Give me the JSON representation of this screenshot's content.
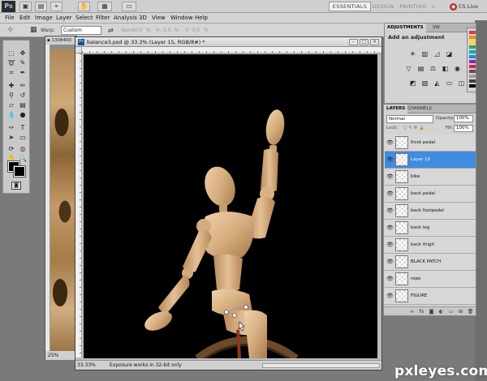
{
  "app": {
    "logo": "Ps",
    "workspaces": [
      "ESSENTIALS",
      "DESIGN",
      "PAINTING",
      "»"
    ],
    "cslive": "CS Live"
  },
  "menu": [
    "File",
    "Edit",
    "Image",
    "Layer",
    "Select",
    "Filter",
    "Analysis",
    "3D",
    "View",
    "Window",
    "Help"
  ],
  "options": {
    "warp_label": "Warp:",
    "warp_value": "Custom",
    "bend_label": "Bend:",
    "bend_value": "0.0",
    "pct": "%",
    "h_label": "H:",
    "h_value": "0.0",
    "v_label": "V:",
    "v_value": "0.0"
  },
  "bg_document": {
    "tab": "1308400",
    "zoom": "25%"
  },
  "document": {
    "title": "balance3.psd @ 33.3% (Layer 15, RGB/8#) *",
    "zoom": "33.33%",
    "status": "Exposure works in 32-bit only"
  },
  "adjustments": {
    "tab": "ADJUSTMENTS",
    "tab2": "SW",
    "title": "Add an adjustment"
  },
  "layers": {
    "tab": "LAYERS",
    "tab2": "CHANNELS",
    "blend_mode": "Normal",
    "opacity_label": "Opacity:",
    "opacity": "100%",
    "lock_label": "Lock:",
    "fill_label": "Fill:",
    "fill": "100%",
    "items": [
      {
        "name": "front pedal",
        "selected": false
      },
      {
        "name": "Layer 15",
        "selected": true
      },
      {
        "name": "bike",
        "selected": false
      },
      {
        "name": "back pedal",
        "selected": false
      },
      {
        "name": "back footpedal",
        "selected": false
      },
      {
        "name": "back leg",
        "selected": false
      },
      {
        "name": "back thigh",
        "selected": false
      },
      {
        "name": "BLACK PATCH",
        "selected": false
      },
      {
        "name": "rope",
        "selected": false
      },
      {
        "name": "FIGURE",
        "selected": false
      }
    ]
  },
  "watermark": "pxleyes.com",
  "colors": {
    "accent": "#3f8ce0",
    "canvas": "#000000",
    "wood": "#d2a878"
  }
}
